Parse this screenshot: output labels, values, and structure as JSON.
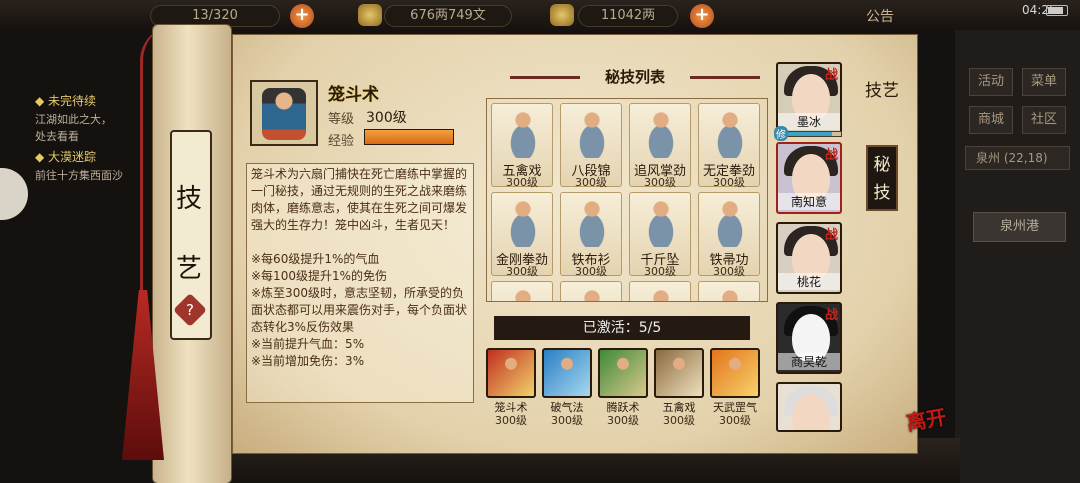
{
  "hud": {
    "storage_count": "13/320",
    "silver_text": "676两749文",
    "gold_text": "11042两",
    "notice_label": "公告",
    "time": "04:25"
  },
  "quests": {
    "unfinished_title": "◆ 未完待续",
    "unfinished_desc": "江湖如此之大，",
    "unfinished_desc2": "处去看看",
    "desert_title": "◆ 大漠迷踪",
    "desert_desc": "前往十方集西面沙"
  },
  "right_menu": {
    "activity": "活动",
    "menu": "菜单",
    "shop": "商城",
    "community": "社区",
    "location": "泉州",
    "coords": "(22,18)",
    "port": "泉州港"
  },
  "scroll": {
    "char_top": "技",
    "char_bottom": "艺",
    "help": "?"
  },
  "detail": {
    "name": "笼斗术",
    "level_label": "等级",
    "level_value": "300级",
    "exp_label": "经验",
    "exp_fraction": 1.0,
    "description": "笼斗术为六扇门捕快在死亡磨练中掌握的一门秘技，通过无规则的生死之战来磨练肉体，磨练意志，使其在生死之间可爆发强大的生存力！笼中凶斗，生者见天！",
    "effects": [
      "※每60级提升1%的气血",
      "※每100级提升1%的免伤",
      "※炼至300级时，意志坚韧，所承受的负面状态都可以用来震伤对手，每个负面状态转化3%反伤效果",
      "※当前提升气血：5%",
      "※当前增加免伤：3%"
    ]
  },
  "list": {
    "title": "秘技列表",
    "skills": [
      {
        "name": "五禽戏",
        "level": "300级"
      },
      {
        "name": "八段锦",
        "level": "300级"
      },
      {
        "name": "追风掌劲",
        "level": "300级"
      },
      {
        "name": "无定拳劲",
        "level": "300级"
      },
      {
        "name": "金刚拳劲",
        "level": "300级"
      },
      {
        "name": "铁布衫",
        "level": "300级"
      },
      {
        "name": "千斤坠",
        "level": "300级"
      },
      {
        "name": "铁帚功",
        "level": "300级"
      }
    ]
  },
  "active": {
    "label": "已激活：5/5",
    "skills": [
      {
        "name": "笼斗术",
        "level": "300级"
      },
      {
        "name": "破气法",
        "level": "300级"
      },
      {
        "name": "腾跃术",
        "level": "300级"
      },
      {
        "name": "五禽戏",
        "level": "300级"
      },
      {
        "name": "天武罡气",
        "level": "300级"
      }
    ]
  },
  "team": {
    "battle_mark": "战",
    "members": [
      {
        "name": "墨冰"
      },
      {
        "name": "南知意"
      },
      {
        "name": "桃花"
      },
      {
        "name": "商昊乾"
      }
    ],
    "hp_fraction": 0.85,
    "hp_tag": "修"
  },
  "tabs": {
    "skills": "技艺",
    "secret": "秘技"
  },
  "leave_label": "离开",
  "colors": {
    "accent_orange": "#e07a1e",
    "battle_red": "#c0251c",
    "parchment": "#eadbb7"
  }
}
